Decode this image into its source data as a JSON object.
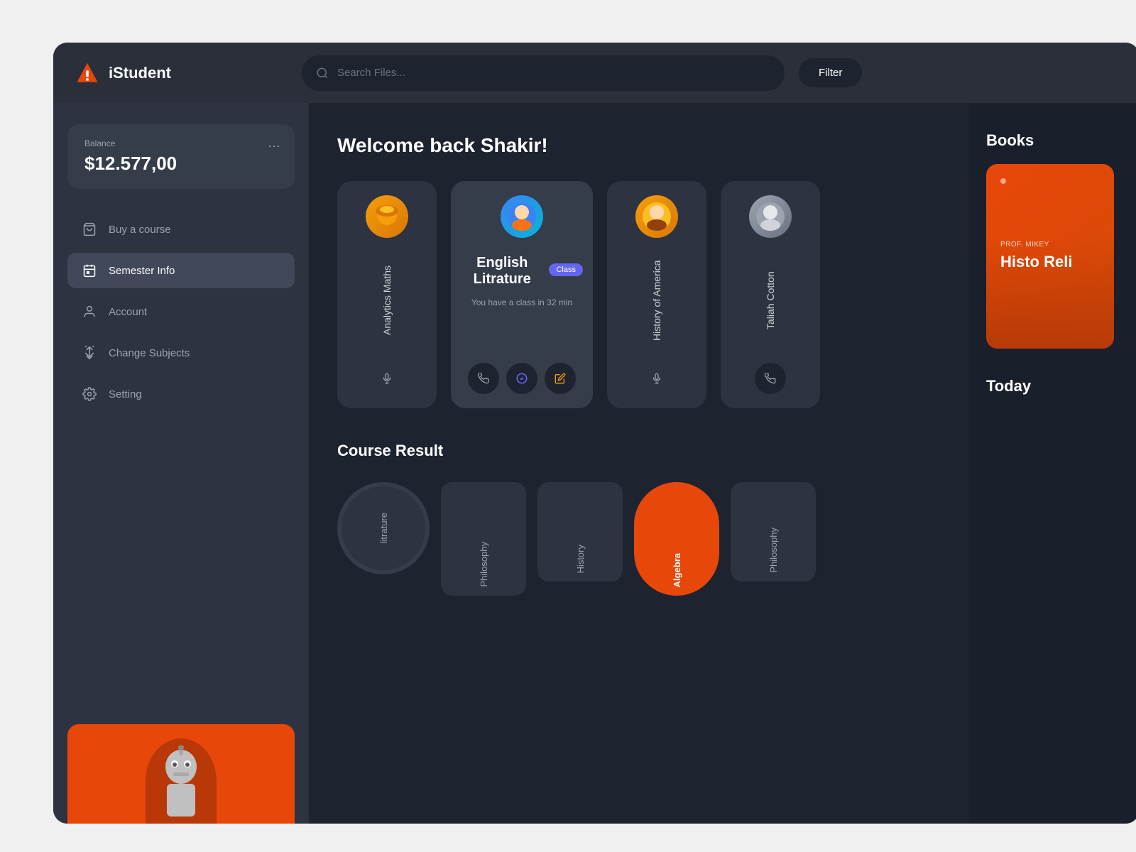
{
  "app": {
    "name": "iStudent"
  },
  "header": {
    "search_placeholder": "Search Files...",
    "filter_label": "Filter"
  },
  "sidebar": {
    "balance_label": "Balance",
    "balance_amount": "$12.577,00",
    "nav_items": [
      {
        "id": "buy-course",
        "label": "Buy a course",
        "icon": "bag"
      },
      {
        "id": "semester-info",
        "label": "Semester Info",
        "icon": "calendar",
        "active": true
      },
      {
        "id": "account",
        "label": "Account",
        "icon": "user"
      },
      {
        "id": "change-subjects",
        "label": "Change Subjects",
        "icon": "arrows-updown"
      },
      {
        "id": "setting",
        "label": "Setting",
        "icon": "gear"
      }
    ]
  },
  "welcome": {
    "title": "Welcome back Shakir!",
    "more_label": "..."
  },
  "subjects": [
    {
      "id": "analytics-maths",
      "name": "Analytics Maths",
      "avatar_type": "orange",
      "action": "mic"
    },
    {
      "id": "english-litrature",
      "name": "English Litrature",
      "class_label": "Class",
      "time_text": "You have a class in 32 min",
      "avatar_type": "blue",
      "featured": true,
      "actions": [
        "phone",
        "check",
        "pencil"
      ]
    },
    {
      "id": "history-of-america",
      "name": "History of America",
      "avatar_type": "orange",
      "action": "mic"
    },
    {
      "id": "taliah-cotton",
      "name": "Taliah Cotton",
      "avatar_type": "gray",
      "action": "phone"
    }
  ],
  "course_result": {
    "title": "Course Result",
    "more_label": "...",
    "items": [
      {
        "label": "litrature",
        "type": "circle"
      },
      {
        "label": "Philosophy",
        "type": "dark"
      },
      {
        "label": "History",
        "type": "dark"
      },
      {
        "label": "Algebra",
        "type": "orange"
      },
      {
        "label": "Philosophy",
        "type": "dark"
      }
    ]
  },
  "books": {
    "title": "Books",
    "featured_book": {
      "prof_label": "PROF. MIKEY",
      "title": "Histo Reli"
    }
  },
  "today": {
    "title": "Today"
  }
}
